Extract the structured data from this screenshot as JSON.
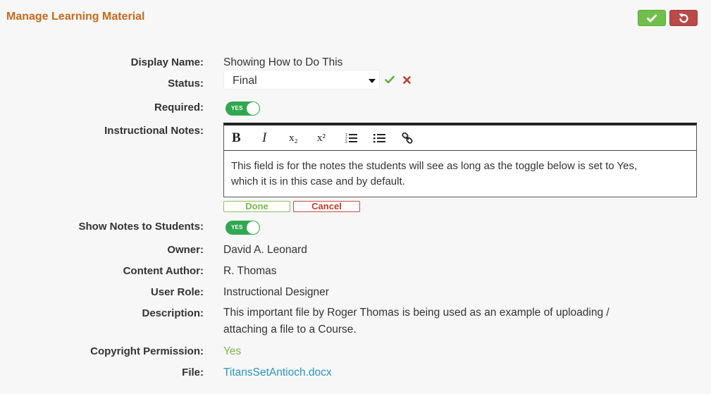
{
  "header": {
    "title": "Manage Learning Material",
    "save_icon": "checkmark-icon",
    "reset_icon": "undo-icon",
    "colors": {
      "title": "#c66a1d",
      "save": "#6fbf4a",
      "reset": "#b84a48"
    }
  },
  "form": {
    "display_name": {
      "label": "Display Name:",
      "value": "Showing How to Do This"
    },
    "status": {
      "label": "Status:",
      "value": "Final"
    },
    "required": {
      "label": "Required:",
      "toggle": "YES"
    },
    "instructional_notes": {
      "label": "Instructional Notes:",
      "toolbar": {
        "bold": "B",
        "italic": "I",
        "subscript": "x₂",
        "superscript": "x²"
      },
      "body": "This field is for the notes the students will see as long as the toggle below is set to Yes, which it is in this case and by default.",
      "done": "Done",
      "cancel": "Cancel"
    },
    "show_notes": {
      "label": "Show Notes to Students:",
      "toggle": "YES"
    },
    "owner": {
      "label": "Owner:",
      "value": "David A. Leonard"
    },
    "content_author": {
      "label": "Content Author:",
      "value": "R. Thomas"
    },
    "user_role": {
      "label": "User Role:",
      "value": "Instructional Designer"
    },
    "description": {
      "label": "Description:",
      "value": "This important file by Roger Thomas is being used as an example of uploading / attaching a file to a Course."
    },
    "copyright": {
      "label": "Copyright Permission:",
      "value": "Yes"
    },
    "file": {
      "label": "File:",
      "value": "TitansSetAntioch.docx"
    }
  }
}
